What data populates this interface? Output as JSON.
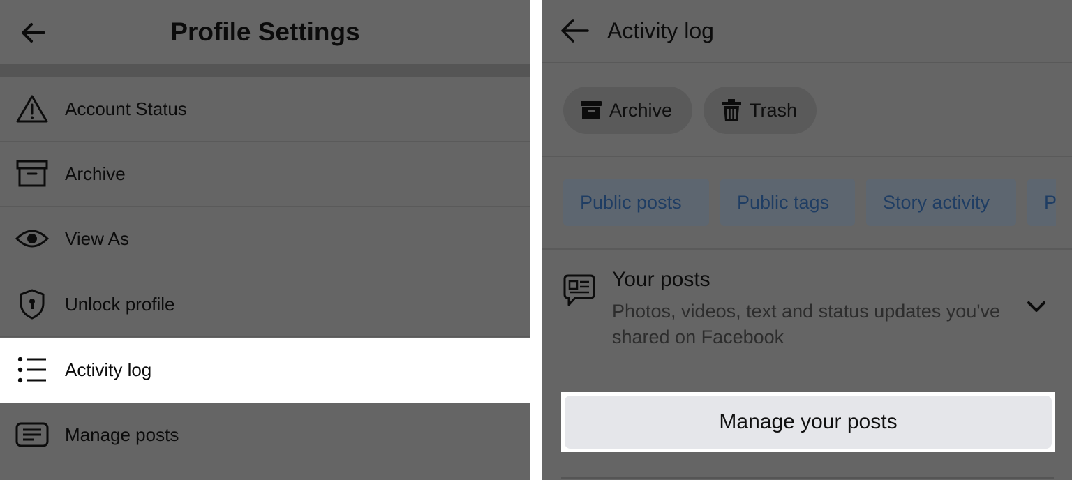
{
  "left": {
    "header": {
      "title": "Profile Settings",
      "back_icon": "arrow-left-icon"
    },
    "menu": [
      {
        "label": "Account Status",
        "icon": "warning-triangle-icon"
      },
      {
        "label": "Archive",
        "icon": "archive-box-icon"
      },
      {
        "label": "View As",
        "icon": "eye-icon"
      },
      {
        "label": "Unlock profile",
        "icon": "shield-lock-icon"
      },
      {
        "label": "Activity log",
        "icon": "list-icon",
        "active": true
      },
      {
        "label": "Manage posts",
        "icon": "message-box-icon"
      }
    ]
  },
  "right": {
    "header": {
      "title": "Activity log",
      "back_icon": "arrow-left-icon"
    },
    "pills": [
      {
        "label": "Archive",
        "icon": "archive-icon"
      },
      {
        "label": "Trash",
        "icon": "trash-icon"
      }
    ],
    "chips": [
      "Public posts",
      "Public tags",
      "Story activity",
      "P"
    ],
    "your_posts": {
      "title": "Your posts",
      "description": "Photos, videos, text and status updates you've shared on Facebook",
      "icon": "speech-bubble-icon",
      "chevron_icon": "chevron-down-icon"
    },
    "manage_button": "Manage your posts"
  },
  "colors": {
    "overlay": "#656565",
    "highlight": "#ffffff",
    "chip_text": "#1f3d63",
    "button_bg": "#e5e6ea"
  }
}
